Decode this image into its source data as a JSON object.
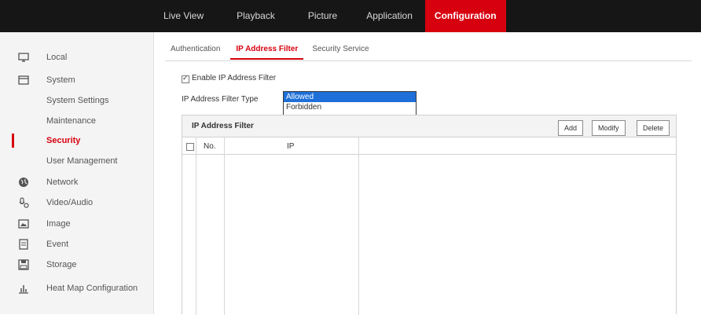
{
  "topnav": {
    "items": [
      {
        "label": "Live View"
      },
      {
        "label": "Playback"
      },
      {
        "label": "Picture"
      },
      {
        "label": "Application"
      },
      {
        "label": "Configuration",
        "active": true
      }
    ]
  },
  "sidebar": {
    "items": [
      {
        "label": "Local",
        "icon": "monitor-icon"
      },
      {
        "label": "System",
        "icon": "system-icon"
      },
      {
        "label": "System Settings"
      },
      {
        "label": "Maintenance"
      },
      {
        "label": "Security",
        "active": true
      },
      {
        "label": "User Management"
      },
      {
        "label": "Network",
        "icon": "globe-icon"
      },
      {
        "label": "Video/Audio",
        "icon": "audio-video-icon"
      },
      {
        "label": "Image",
        "icon": "image-icon"
      },
      {
        "label": "Event",
        "icon": "event-icon"
      },
      {
        "label": "Storage",
        "icon": "storage-icon"
      },
      {
        "label": "Heat Map Configuration",
        "icon": "heatmap-icon"
      }
    ]
  },
  "tabs": [
    {
      "label": "Authentication"
    },
    {
      "label": "IP Address Filter",
      "active": true
    },
    {
      "label": "Security Service"
    }
  ],
  "form": {
    "enable_label": "Enable IP Address Filter",
    "enable_checked": true,
    "filter_type_label": "IP Address Filter Type",
    "filter_type_options": [
      "Allowed",
      "Forbidden"
    ],
    "filter_type_selected": "Allowed"
  },
  "panel": {
    "title": "IP Address Filter",
    "buttons": {
      "add": "Add",
      "modify": "Modify",
      "delete": "Delete"
    },
    "columns": {
      "no": "No.",
      "ip": "IP"
    }
  },
  "colors": {
    "accent": "#d7000f",
    "topbar": "#161616",
    "selection": "#1e6fd9"
  }
}
